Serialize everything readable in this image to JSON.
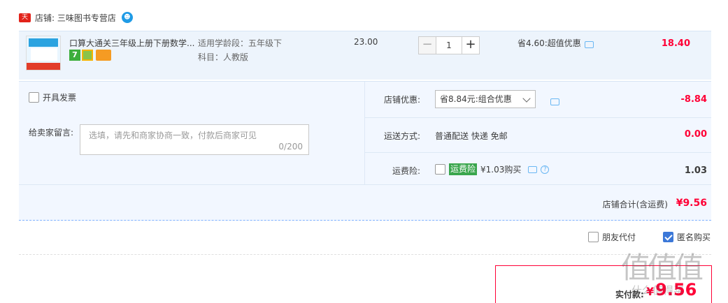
{
  "shop": {
    "tmall_badge": "天猫",
    "label": "店铺: 三味图书专营店"
  },
  "item": {
    "title": "口算大通关三年级上册下册数学...",
    "badge_seven": "7",
    "sku_stage": "适用学龄段：五年级下",
    "sku_subject": "科目：人教版",
    "unit_price": "23.00",
    "qty_minus": "−",
    "qty_value": "1",
    "qty_plus": "+",
    "saving": "省4.60:超值优惠",
    "subtotal": "18.40"
  },
  "options": {
    "invoice_label": "开具发票",
    "message_label": "给卖家留言:",
    "message_placeholder": "选填，请先和商家协商一致，付款后商家可见",
    "message_count": "0/200",
    "discount_label": "店铺优惠:",
    "discount_selected": "省8.84元:组合优惠",
    "discount_value": "-8.84",
    "shipping_label": "运送方式:",
    "shipping_value": "普通配送 快递 免邮",
    "shipping_price": "0.00",
    "insurance_label": "运费险:",
    "insurance_tag": "运费险",
    "insurance_text": "¥1.03购买",
    "insurance_help": "?",
    "insurance_value": "1.03",
    "shop_total_label": "店铺合计(含运费)",
    "shop_total_value": "¥9.56"
  },
  "checkout": {
    "friend_pay": "朋友代付",
    "anon_buy": "匿名购买",
    "anon_checked": true,
    "pay_label": "实付款:",
    "pay_currency": "¥",
    "pay_amount": "9.56"
  },
  "watermark": {
    "main": "值值值",
    "sub": "什么值得买"
  },
  "colors": {
    "price_red": "#ff0036",
    "row_bg": "#edf4fc",
    "panel_bg": "#f2f7ff",
    "checkbox_blue": "#3c78d8",
    "insurance_green": "#3aa64d"
  }
}
